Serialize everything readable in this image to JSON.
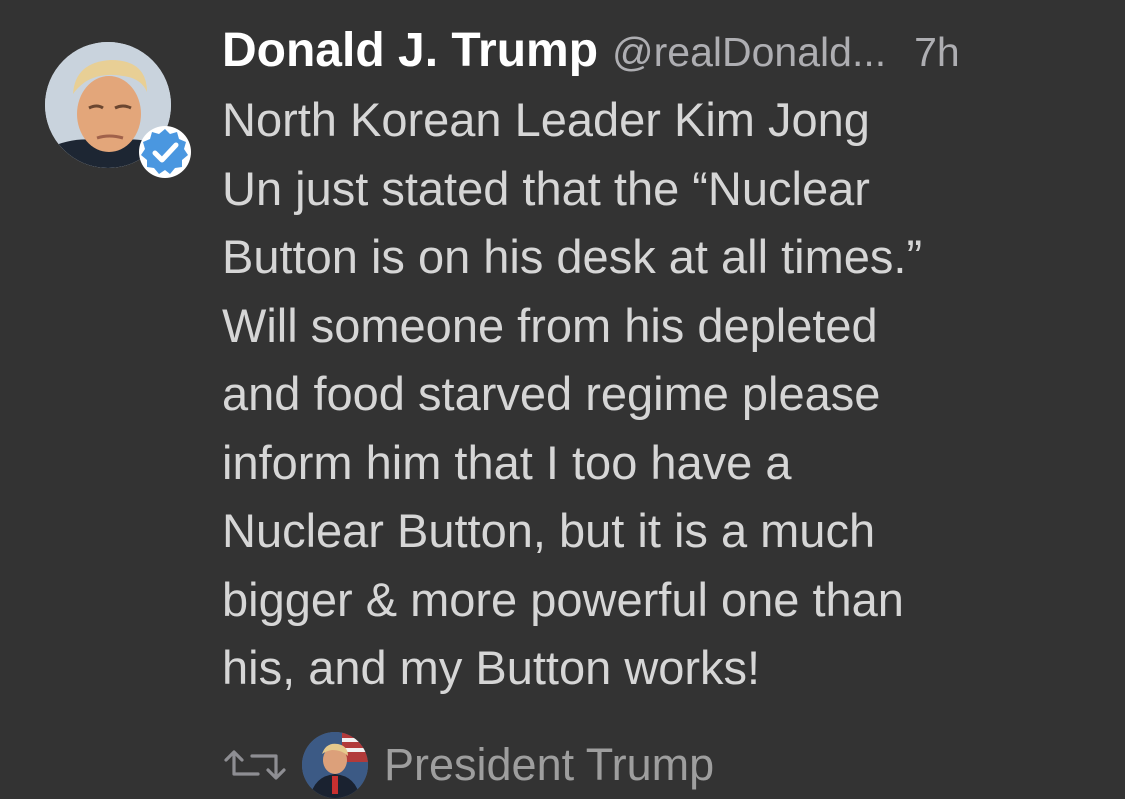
{
  "tweet": {
    "author_name": "Donald J. Trump",
    "handle": "@realDonald...",
    "time": "7h",
    "verified": true,
    "text_lines": [
      "North Korean Leader Kim Jong",
      "Un just stated that the “Nuclear",
      "Button is on his desk at all times.”",
      "Will someone from his depleted",
      "and food starved regime please",
      "inform him that I too have a",
      "Nuclear Button, but it is a much",
      "bigger & more powerful one than",
      "his, and my Button works!"
    ]
  },
  "retweeted_by": {
    "label": "President Trump"
  },
  "colors": {
    "background": "#333333",
    "name": "#ffffff",
    "body_text": "#d6d6d6",
    "meta_text": "#aeaeb2",
    "verified_blue": "#1da1f2"
  },
  "icons": {
    "verified": "verified-badge-icon",
    "retweet": "retweet-icon"
  }
}
